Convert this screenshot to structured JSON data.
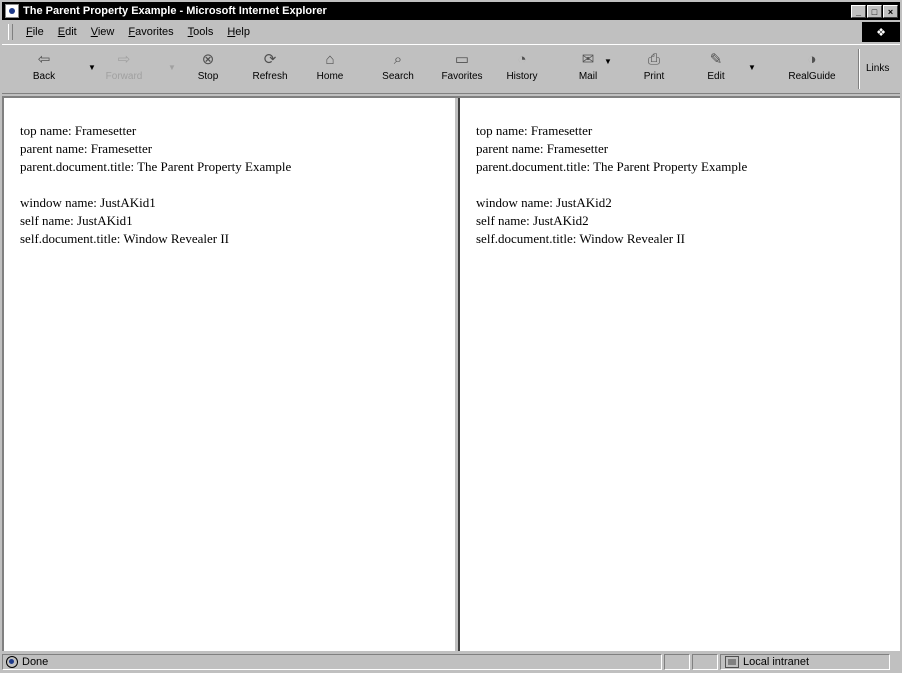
{
  "window": {
    "title": "The Parent Property Example - Microsoft Internet Explorer",
    "controls": {
      "minimize": "_",
      "maximize": "□",
      "close": "×"
    }
  },
  "menu": [
    "File",
    "Edit",
    "View",
    "Favorites",
    "Tools",
    "Help"
  ],
  "toolbar": {
    "buttons": [
      {
        "label": "Back",
        "icon": "back-arrow-icon",
        "glyph": "⇦"
      },
      {
        "label": "Forward",
        "icon": "forward-arrow-icon",
        "glyph": "⇨"
      },
      {
        "label": "Stop",
        "icon": "stop-icon",
        "glyph": "⊗"
      },
      {
        "label": "Refresh",
        "icon": "refresh-icon",
        "glyph": "⟳"
      },
      {
        "label": "Home",
        "icon": "home-icon",
        "glyph": "⌂"
      },
      {
        "label": "Search",
        "icon": "search-icon",
        "glyph": "⌕"
      },
      {
        "label": "Favorites",
        "icon": "favorites-icon",
        "glyph": "▭"
      },
      {
        "label": "History",
        "icon": "history-icon",
        "glyph": "◔"
      },
      {
        "label": "Mail",
        "icon": "mail-icon",
        "glyph": "✉"
      },
      {
        "label": "Print",
        "icon": "print-icon",
        "glyph": "⎙"
      },
      {
        "label": "Edit",
        "icon": "edit-icon",
        "glyph": "✎"
      },
      {
        "label": "RealGuide",
        "icon": "realguide-icon",
        "glyph": "◑"
      }
    ],
    "links_label": "Links"
  },
  "frames": {
    "left": {
      "top_name": "top name: Framesetter",
      "parent_name": "parent name: Framesetter",
      "parent_title": "parent.document.title: The Parent Property Example",
      "window_name": "window name: JustAKid1",
      "self_name": "self name: JustAKid1",
      "self_title": "self.document.title: Window Revealer II"
    },
    "right": {
      "top_name": "top name: Framesetter",
      "parent_name": "parent name: Framesetter",
      "parent_title": "parent.document.title: The Parent Property Example",
      "window_name": "window name: JustAKid2",
      "self_name": "self name: JustAKid2",
      "self_title": "self.document.title: Window Revealer II"
    }
  },
  "status": {
    "text": "Done",
    "zone": "Local intranet"
  }
}
